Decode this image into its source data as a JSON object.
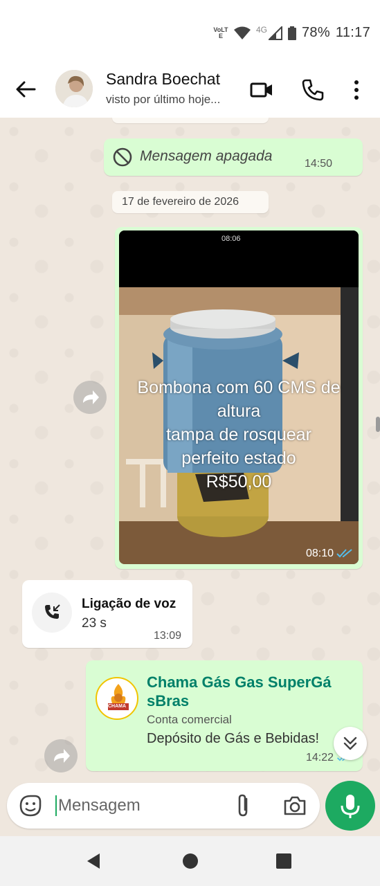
{
  "status_bar": {
    "volte_label": "VoLTE",
    "network_label": "4G",
    "battery": "78%",
    "clock": "11:17"
  },
  "header": {
    "contact_name": "Sandra Boechat",
    "last_seen": "visto por último hoje..."
  },
  "messages": {
    "deleted": {
      "text": "Mensagem apagada",
      "time": "14:50"
    },
    "date_chip": "17 de fevereiro de 2026",
    "image": {
      "phone_clock": "08:06",
      "caption_lines": [
        "Bombona com 60 CMS de",
        "altura",
        "tampa de rosquear",
        "perfeito estado",
        "R$50,00"
      ],
      "time": "08:10"
    },
    "voice_call": {
      "title": "Ligação de voz",
      "duration": "23 s",
      "time": "13:09"
    },
    "contact_card": {
      "name_line1": "Chama Gás Gas SuperGá",
      "name_line2": "sBras",
      "type": "Conta comercial",
      "description": "Depósito de Gás e Bebidas!",
      "time": "14:22",
      "logo_text": "CHAMA"
    }
  },
  "composer": {
    "placeholder": "Mensagem"
  },
  "colors": {
    "accent": "#1daa61",
    "bubble_out": "#d9fdd3",
    "link": "#008069"
  }
}
